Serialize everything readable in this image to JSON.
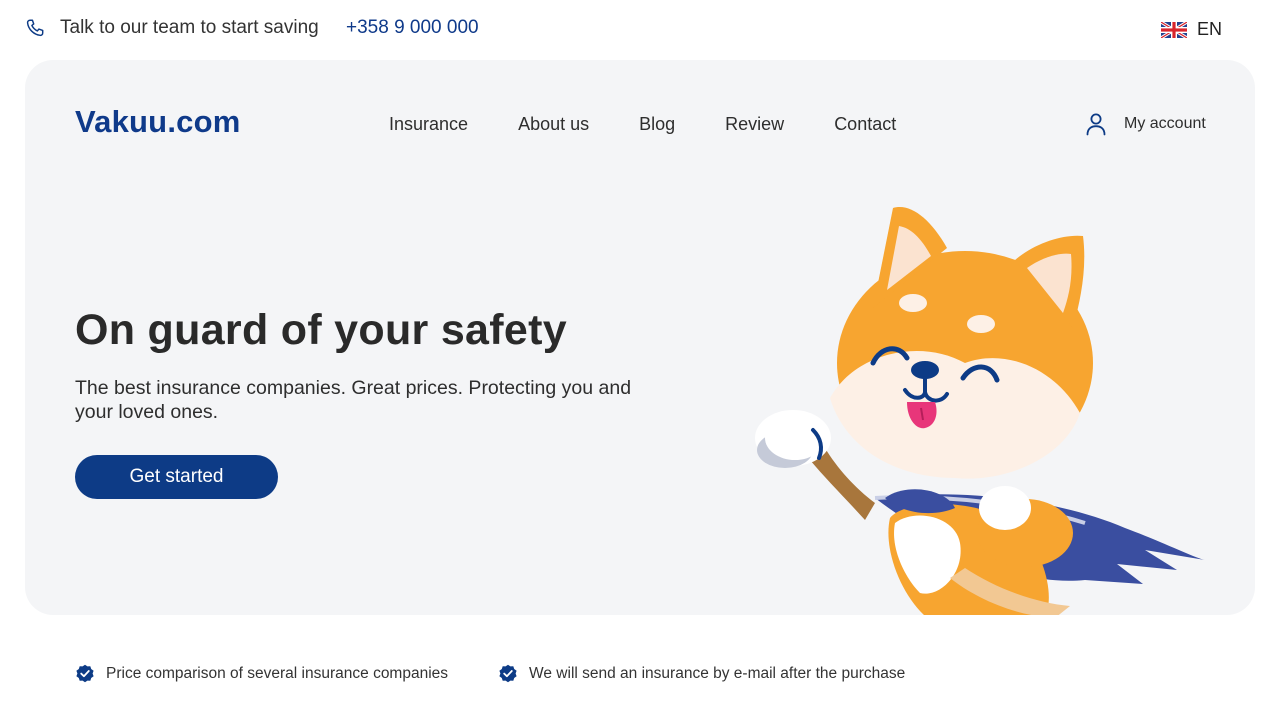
{
  "topbar": {
    "talk_text": "Talk to our team to start saving",
    "phone": "+358 9 000 000",
    "language": "EN"
  },
  "header": {
    "logo": "Vakuu.com",
    "nav": [
      "Insurance",
      "About us",
      "Blog",
      "Review",
      "Contact"
    ],
    "account_label": "My account"
  },
  "hero": {
    "title": "On guard of your safety",
    "subtitle": "The best insurance companies. Great prices. Protecting you and your loved ones.",
    "cta_label": "Get started"
  },
  "features": [
    "Price comparison of several insurance companies",
    "We will send an insurance by e-mail after the purchase"
  ],
  "colors": {
    "brand": "#0d3b86",
    "hero_background": "#f4f5f7",
    "mascot_orange": "#f7a530",
    "cape": "#3a4ea0"
  },
  "icons": [
    "phone-icon",
    "uk-flag-icon",
    "user-icon",
    "check-badge-icon"
  ]
}
